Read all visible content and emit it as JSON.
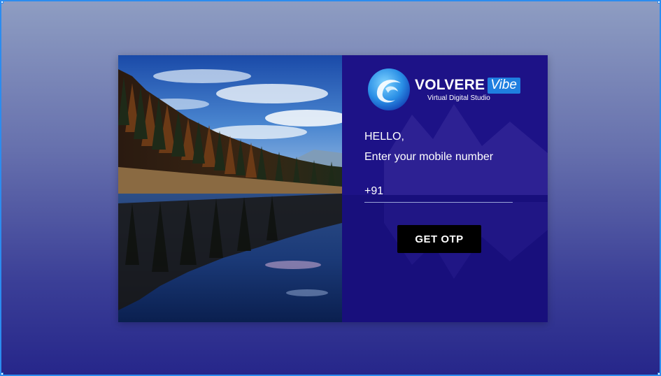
{
  "brand": {
    "name": "VOLVERE",
    "tag": "Vibe",
    "subtitle": "Virtual Digital Studio"
  },
  "login": {
    "greeting": "HELLO,",
    "prompt": "Enter your mobile number",
    "phone_prefix": "+91",
    "phone_value": "",
    "submit_label": "GET OTP"
  },
  "colors": {
    "panel": "#1d1287",
    "button": "#000000",
    "brand_tag_bg": "#1f7fe0",
    "selection_border": "#2b8cf0"
  },
  "icons": {
    "logo": "swirl-orb-logo-icon"
  }
}
